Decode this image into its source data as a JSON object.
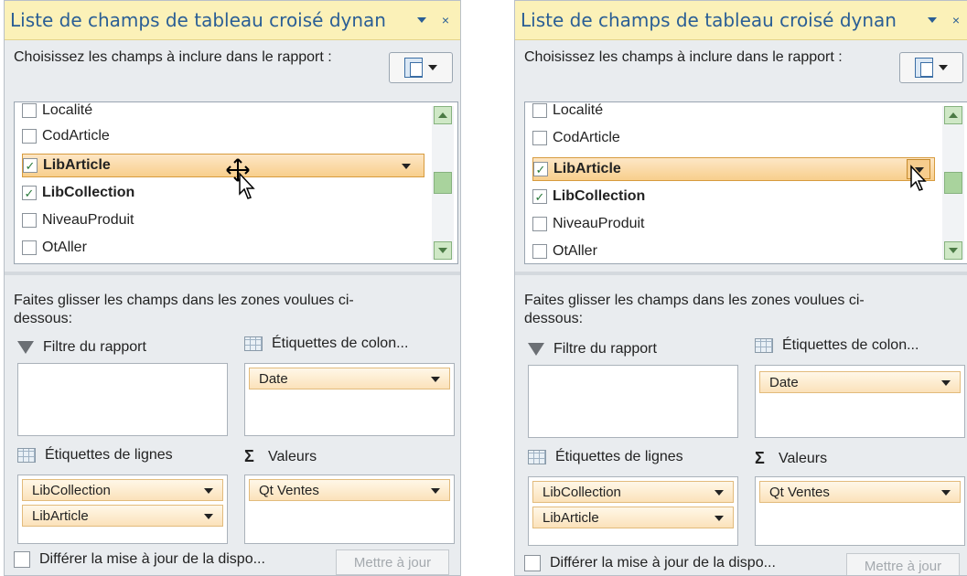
{
  "panels": [
    {
      "title": "Liste de champs de tableau croisé dynan",
      "choose_text": "Choisissez les champs à inclure dans le rapport :",
      "fields": [
        {
          "label": "Localité",
          "checked": false
        },
        {
          "label": "CodArticle",
          "checked": false
        },
        {
          "label": "LibArticle",
          "checked": true
        },
        {
          "label": "LibCollection",
          "checked": true
        },
        {
          "label": "NiveauProduit",
          "checked": false
        },
        {
          "label": "OtAller",
          "checked": false
        }
      ],
      "drag_text": "Faites glisser les champs dans les zones voulues ci-dessous:",
      "areas": {
        "report_filter": {
          "label": "Filtre du rapport",
          "items": []
        },
        "column_labels": {
          "label": "Étiquettes de colon...",
          "items": [
            "Date"
          ]
        },
        "row_labels": {
          "label": "Étiquettes de lignes",
          "items": [
            "LibCollection",
            "LibArticle"
          ]
        },
        "values": {
          "label": "Valeurs",
          "items": [
            "Qt Ventes"
          ]
        }
      },
      "defer_label": "Différer la mise à jour de la dispo...",
      "update_button": "Mettre à jour"
    },
    {
      "title": "Liste de champs de tableau croisé dynan",
      "choose_text": "Choisissez les champs à inclure dans le rapport :",
      "fields": [
        {
          "label": "Localité",
          "checked": false
        },
        {
          "label": "CodArticle",
          "checked": false
        },
        {
          "label": "LibArticle",
          "checked": true
        },
        {
          "label": "LibCollection",
          "checked": true
        },
        {
          "label": "NiveauProduit",
          "checked": false
        },
        {
          "label": "OtAller",
          "checked": false
        }
      ],
      "drag_text": "Faites glisser les champs dans les zones voulues ci-dessous:",
      "areas": {
        "report_filter": {
          "label": "Filtre du rapport",
          "items": []
        },
        "column_labels": {
          "label": "Étiquettes de colon...",
          "items": [
            "Date"
          ]
        },
        "row_labels": {
          "label": "Étiquettes de lignes",
          "items": [
            "LibCollection",
            "LibArticle"
          ]
        },
        "values": {
          "label": "Valeurs",
          "items": [
            "Qt Ventes"
          ]
        }
      },
      "defer_label": "Différer la mise à jour de la dispo...",
      "update_button": "Mettre à jour"
    }
  ],
  "colors": {
    "title_bg": "#fbf1b8",
    "title_text": "#2a5e95",
    "highlight": "#f8cf8c",
    "pane_bg": "#e9ecef"
  },
  "icons": {
    "check": "✓",
    "close": "×",
    "dropdown": "chevron-down-icon"
  }
}
